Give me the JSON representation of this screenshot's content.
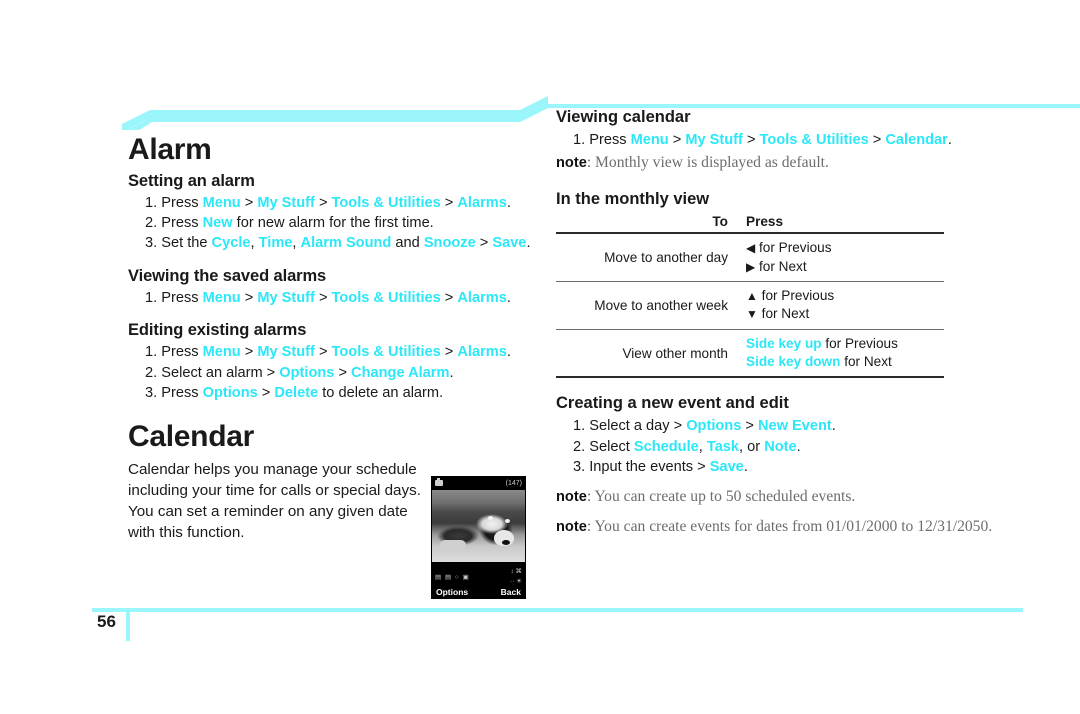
{
  "page": {
    "number": "56",
    "accent_cyan": "#2ce7f7",
    "band_cyan": "#9bf6fb"
  },
  "left_column": {
    "chapter_alarm": "Alarm",
    "sections": [
      {
        "heading": "Setting an alarm",
        "steps": [
          {
            "num": "1.",
            "parts": [
              {
                "t": "Press ",
                "k": false
              },
              {
                "t": "Menu",
                "k": true
              },
              {
                "t": " > ",
                "k": false
              },
              {
                "t": "My Stuff",
                "k": true
              },
              {
                "t": " > ",
                "k": false
              },
              {
                "t": "Tools & Utilities",
                "k": true
              },
              {
                "t": " > ",
                "k": false
              },
              {
                "t": "Alarms",
                "k": true
              },
              {
                "t": ".",
                "k": false
              }
            ]
          },
          {
            "num": "2.",
            "parts": [
              {
                "t": "Press ",
                "k": false
              },
              {
                "t": "New",
                "k": true
              },
              {
                "t": " for new alarm for the first time.",
                "k": false
              }
            ]
          },
          {
            "num": "3.",
            "parts": [
              {
                "t": "Set the ",
                "k": false
              },
              {
                "t": "Cycle",
                "k": true
              },
              {
                "t": ", ",
                "k": false
              },
              {
                "t": "Time",
                "k": true
              },
              {
                "t": ", ",
                "k": false
              },
              {
                "t": "Alarm Sound",
                "k": true
              },
              {
                "t": " and ",
                "k": false
              },
              {
                "t": "Snooze",
                "k": true
              },
              {
                "t": " > ",
                "k": false
              },
              {
                "t": "Save",
                "k": true
              },
              {
                "t": ".",
                "k": false
              }
            ]
          }
        ]
      },
      {
        "heading": "Viewing the saved alarms",
        "steps": [
          {
            "num": "1.",
            "parts": [
              {
                "t": "Press ",
                "k": false
              },
              {
                "t": "Menu",
                "k": true
              },
              {
                "t": " > ",
                "k": false
              },
              {
                "t": "My Stuff",
                "k": true
              },
              {
                "t": " > ",
                "k": false
              },
              {
                "t": "Tools & Utilities",
                "k": true
              },
              {
                "t": " > ",
                "k": false
              },
              {
                "t": "Alarms",
                "k": true
              },
              {
                "t": ".",
                "k": false
              }
            ]
          }
        ]
      },
      {
        "heading": "Editing existing alarms",
        "steps": [
          {
            "num": "1.",
            "parts": [
              {
                "t": "Press ",
                "k": false
              },
              {
                "t": "Menu",
                "k": true
              },
              {
                "t": " > ",
                "k": false
              },
              {
                "t": "My Stuff",
                "k": true
              },
              {
                "t": " > ",
                "k": false
              },
              {
                "t": "Tools & Utilities",
                "k": true
              },
              {
                "t": " > ",
                "k": false
              },
              {
                "t": "Alarms",
                "k": true
              },
              {
                "t": ".",
                "k": false
              }
            ]
          },
          {
            "num": "2.",
            "parts": [
              {
                "t": "Select an alarm > ",
                "k": false
              },
              {
                "t": "Options",
                "k": true
              },
              {
                "t": " > ",
                "k": false
              },
              {
                "t": "Change Alarm",
                "k": true
              },
              {
                "t": ".",
                "k": false
              }
            ]
          },
          {
            "num": "3.",
            "parts": [
              {
                "t": "Press ",
                "k": false
              },
              {
                "t": "Options",
                "k": true
              },
              {
                "t": " > ",
                "k": false
              },
              {
                "t": "Delete",
                "k": true
              },
              {
                "t": " to delete an alarm.",
                "k": false
              }
            ]
          }
        ]
      }
    ],
    "chapter_calendar": "Calendar",
    "calendar_body": "Calendar helps you manage your schedule including your time for calls or special days. You can set a reminder on any given date with this function."
  },
  "phone_screenshot": {
    "status_count": "(147)",
    "softkey_left": "Options",
    "softkey_right": "Back",
    "icons_left": "▤ ▤ ○ ▣",
    "icons_right_line1": "↕ ⌘",
    "icons_right_line2": "·· ☀"
  },
  "right_column": {
    "viewing_calendar": {
      "heading": "Viewing calendar",
      "steps": [
        {
          "num": "1.",
          "parts": [
            {
              "t": "Press ",
              "k": false
            },
            {
              "t": "Menu",
              "k": true
            },
            {
              "t": " > ",
              "k": false
            },
            {
              "t": "My Stuff",
              "k": true
            },
            {
              "t": " > ",
              "k": false
            },
            {
              "t": "Tools & Utilities",
              "k": true
            },
            {
              "t": " > ",
              "k": false
            },
            {
              "t": "Calendar",
              "k": true
            },
            {
              "t": ".",
              "k": false
            }
          ]
        }
      ],
      "note": "Monthly view is displayed as default.",
      "note_label": "note"
    },
    "monthly_view": {
      "heading": "In the monthly view",
      "table": {
        "headers": [
          "To",
          "Press"
        ],
        "rows": [
          {
            "to": "Move to another day",
            "press": [
              [
                {
                  "t": "◀",
                  "k": false,
                  "arrow": true
                },
                {
                  "t": " for Previous",
                  "k": false
                }
              ],
              [
                {
                  "t": "▶",
                  "k": false,
                  "arrow": true
                },
                {
                  "t": " for Next",
                  "k": false
                }
              ]
            ]
          },
          {
            "to": "Move to another week",
            "press": [
              [
                {
                  "t": "▲",
                  "k": false,
                  "arrow": true
                },
                {
                  "t": " for Previous",
                  "k": false
                }
              ],
              [
                {
                  "t": "▼",
                  "k": false,
                  "arrow": true
                },
                {
                  "t": " for Next",
                  "k": false
                }
              ]
            ]
          },
          {
            "to": "View other month",
            "press": [
              [
                {
                  "t": "Side key up",
                  "k": true
                },
                {
                  "t": " for Previous",
                  "k": false
                }
              ],
              [
                {
                  "t": "Side key down",
                  "k": true
                },
                {
                  "t": " for Next",
                  "k": false
                }
              ]
            ]
          }
        ]
      }
    },
    "new_event": {
      "heading": "Creating a new event and edit",
      "steps": [
        {
          "num": "1.",
          "parts": [
            {
              "t": "Select a day > ",
              "k": false
            },
            {
              "t": "Options",
              "k": true
            },
            {
              "t": " > ",
              "k": false
            },
            {
              "t": "New Event",
              "k": true
            },
            {
              "t": ".",
              "k": false
            }
          ]
        },
        {
          "num": "2.",
          "parts": [
            {
              "t": "Select ",
              "k": false
            },
            {
              "t": "Schedule",
              "k": true
            },
            {
              "t": ", ",
              "k": false
            },
            {
              "t": "Task",
              "k": true
            },
            {
              "t": ", or ",
              "k": false
            },
            {
              "t": "Note",
              "k": true
            },
            {
              "t": ".",
              "k": false
            }
          ]
        },
        {
          "num": "3.",
          "parts": [
            {
              "t": "Input the events > ",
              "k": false
            },
            {
              "t": "Save",
              "k": true
            },
            {
              "t": ".",
              "k": false
            }
          ]
        }
      ],
      "note_label": "note",
      "note1": "You can create up to 50 scheduled events.",
      "note2": "You can create events for dates from 01/01/2000 to 12/31/2050."
    }
  }
}
